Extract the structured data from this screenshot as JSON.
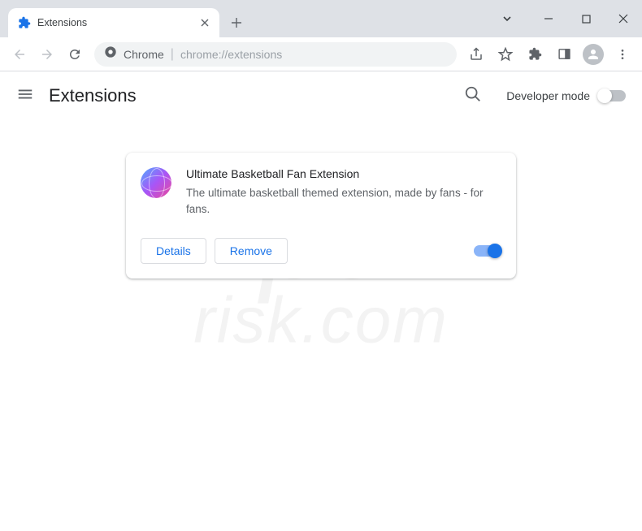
{
  "tab": {
    "title": "Extensions"
  },
  "url": {
    "chrome_label": "Chrome",
    "path": "chrome://extensions"
  },
  "page": {
    "title": "Extensions",
    "developer_mode_label": "Developer mode"
  },
  "extension": {
    "name": "Ultimate Basketball Fan Extension",
    "description": "The ultimate basketball themed extension, made by fans - for fans.",
    "details_label": "Details",
    "remove_label": "Remove",
    "enabled": true
  },
  "watermark": {
    "line1": "pc",
    "line2": "risk.com"
  }
}
